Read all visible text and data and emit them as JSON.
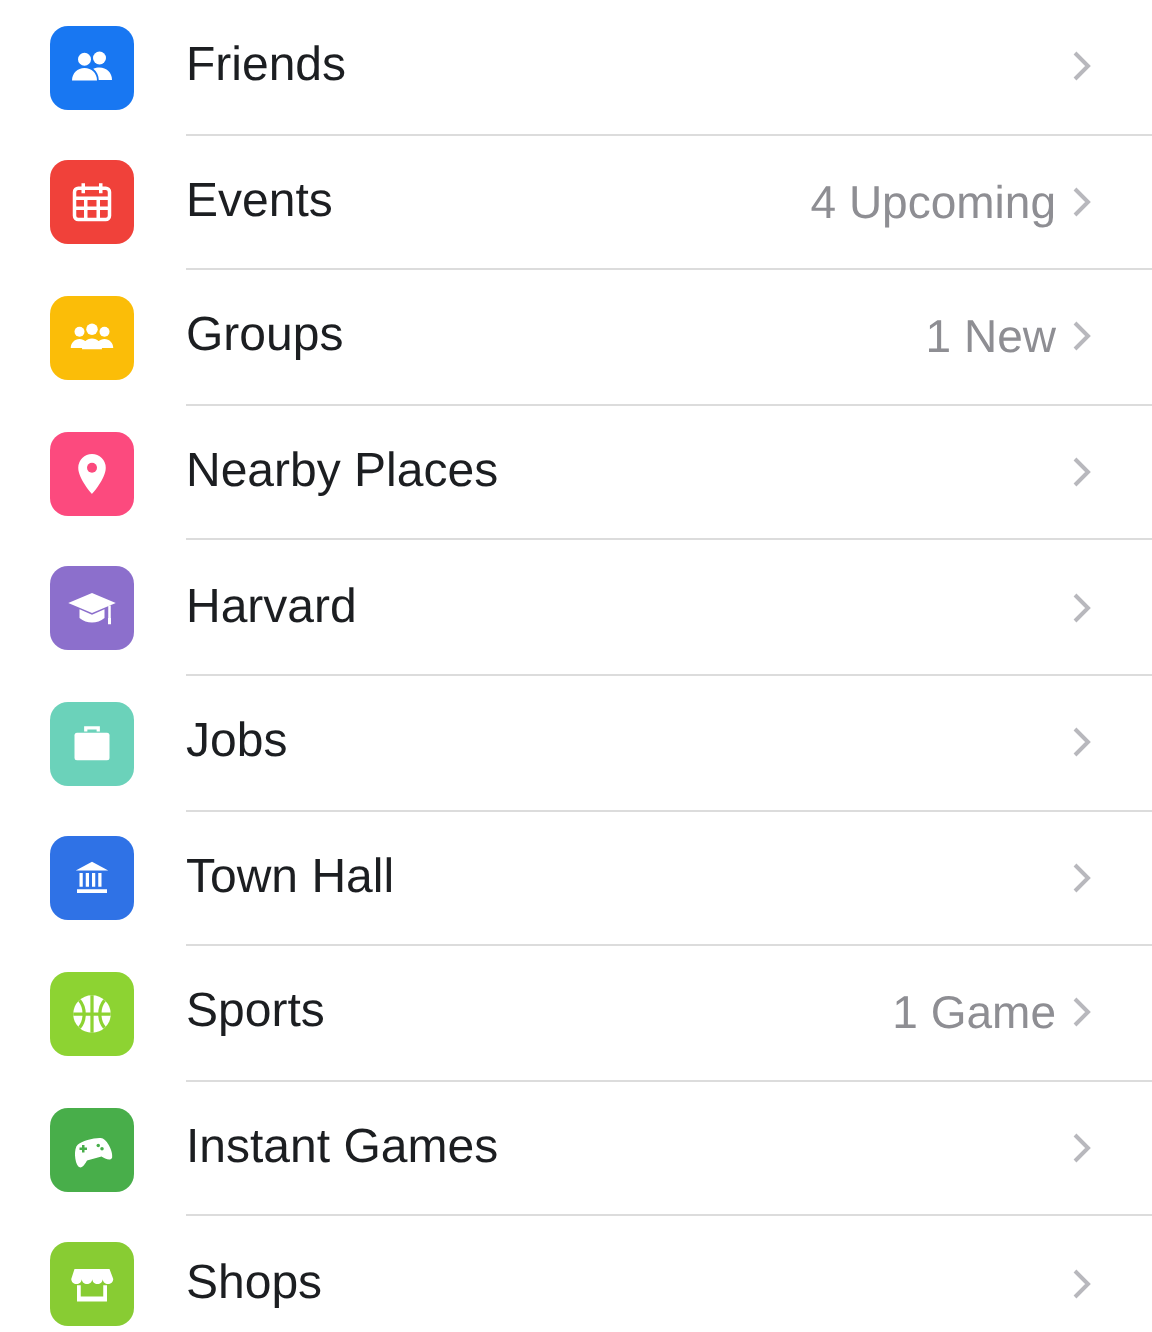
{
  "menu": [
    {
      "label": "Friends",
      "color": "#1877f2"
    },
    {
      "label": "Events",
      "detail": "4 Upcoming",
      "color": "#f0413a"
    },
    {
      "label": "Groups",
      "detail": "1 New",
      "color": "#fbbd08"
    },
    {
      "label": "Nearby Places",
      "color": "#fc4a7e"
    },
    {
      "label": "Harvard",
      "color": "#8c6fcc"
    },
    {
      "label": "Jobs",
      "color": "#6bd2ba"
    },
    {
      "label": "Town Hall",
      "color": "#2f72e6"
    },
    {
      "label": "Sports",
      "detail": "1 Game",
      "color": "#8dd332"
    },
    {
      "label": "Instant Games",
      "color": "#48ae4a"
    },
    {
      "label": "Shops",
      "color": "#88cc33"
    }
  ]
}
